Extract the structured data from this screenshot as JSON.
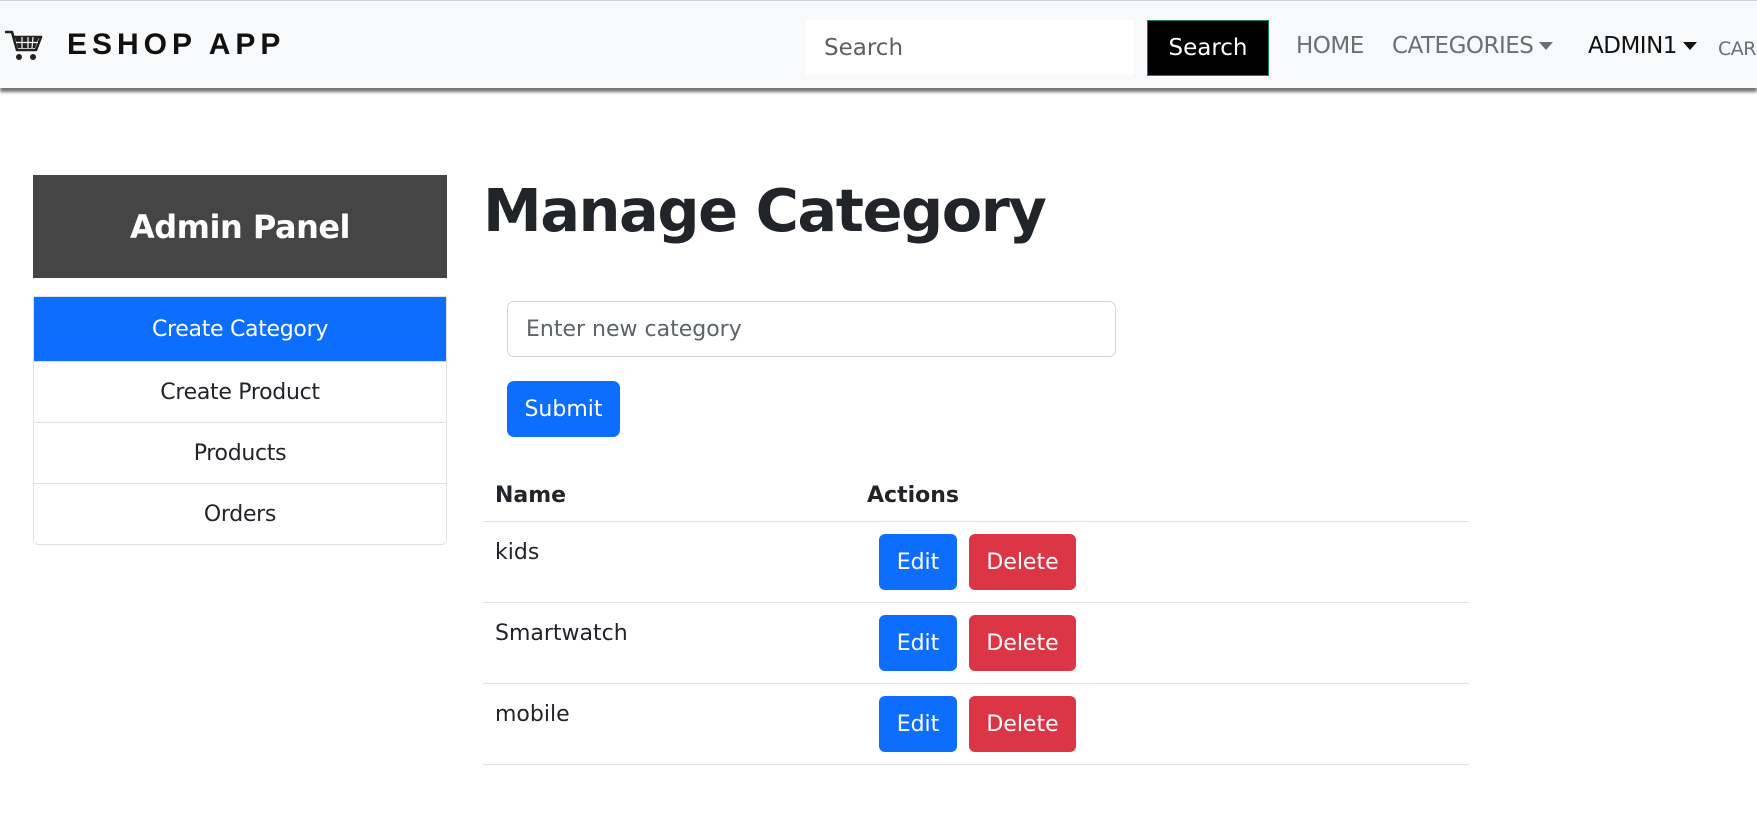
{
  "navbar": {
    "brand": "ESHOP APP",
    "brand_icon": "shopping-cart-icon",
    "search_placeholder": "Search",
    "search_button": "Search",
    "links": {
      "home": "HOME",
      "categories": "CATEGORIES",
      "admin": "ADMIN1",
      "cart": "CAR"
    }
  },
  "sidebar": {
    "title": "Admin Panel",
    "items": [
      {
        "label": "Create Category",
        "active": true
      },
      {
        "label": "Create Product",
        "active": false
      },
      {
        "label": "Products",
        "active": false
      },
      {
        "label": "Orders",
        "active": false
      }
    ]
  },
  "main": {
    "title": "Manage Category",
    "input_placeholder": "Enter new category",
    "input_value": "",
    "submit_label": "Submit",
    "table": {
      "headers": {
        "name": "Name",
        "actions": "Actions"
      },
      "rows": [
        {
          "name": "kids",
          "edit": "Edit",
          "delete": "Delete"
        },
        {
          "name": "Smartwatch",
          "edit": "Edit",
          "delete": "Delete"
        },
        {
          "name": "mobile",
          "edit": "Edit",
          "delete": "Delete"
        }
      ]
    }
  },
  "colors": {
    "primary": "#0d6efd",
    "danger": "#dc3545",
    "panel_header": "#454545",
    "navbar_bg": "#f8f9fa"
  }
}
